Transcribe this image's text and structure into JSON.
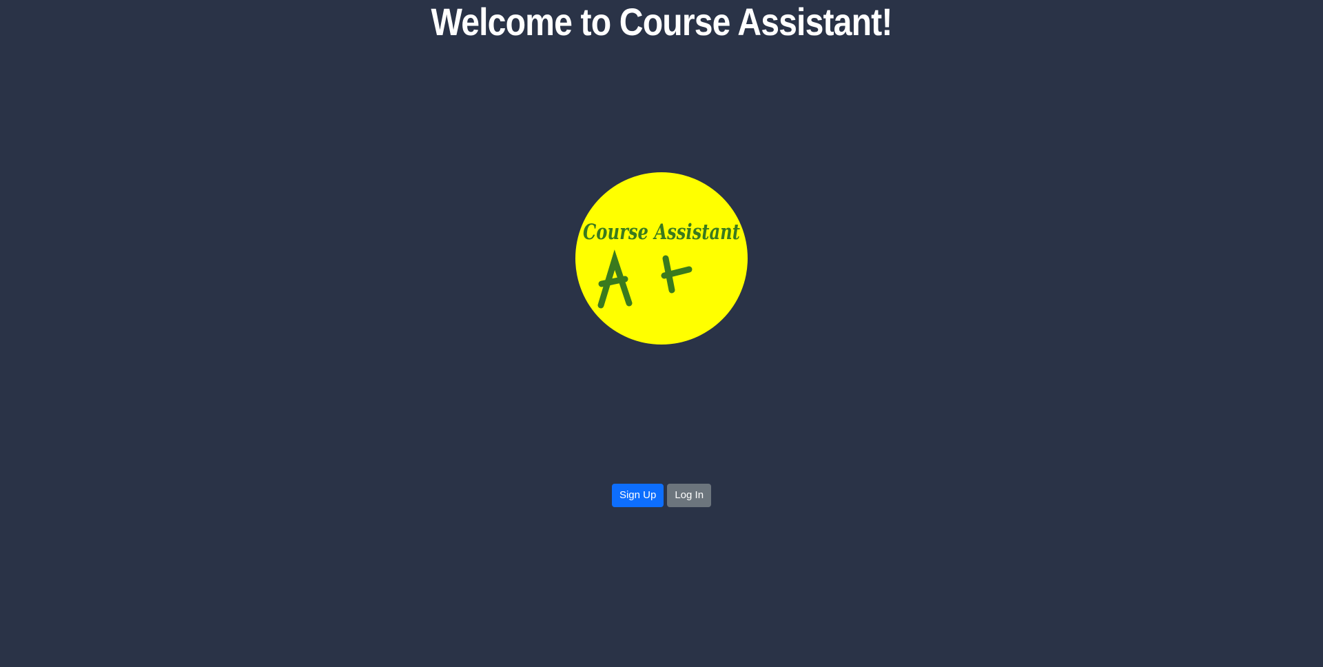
{
  "page": {
    "title": "Welcome to Course Assistant!",
    "background_color": "#2a3347"
  },
  "logo": {
    "text": "Course Assistant",
    "grade": "A+",
    "circle_color": "#ffff00",
    "text_color": "#3a7a1e"
  },
  "actions": {
    "signup_label": "Sign Up",
    "login_label": "Log In",
    "signup_color": "#0d6efd",
    "login_color": "#6c757d"
  }
}
